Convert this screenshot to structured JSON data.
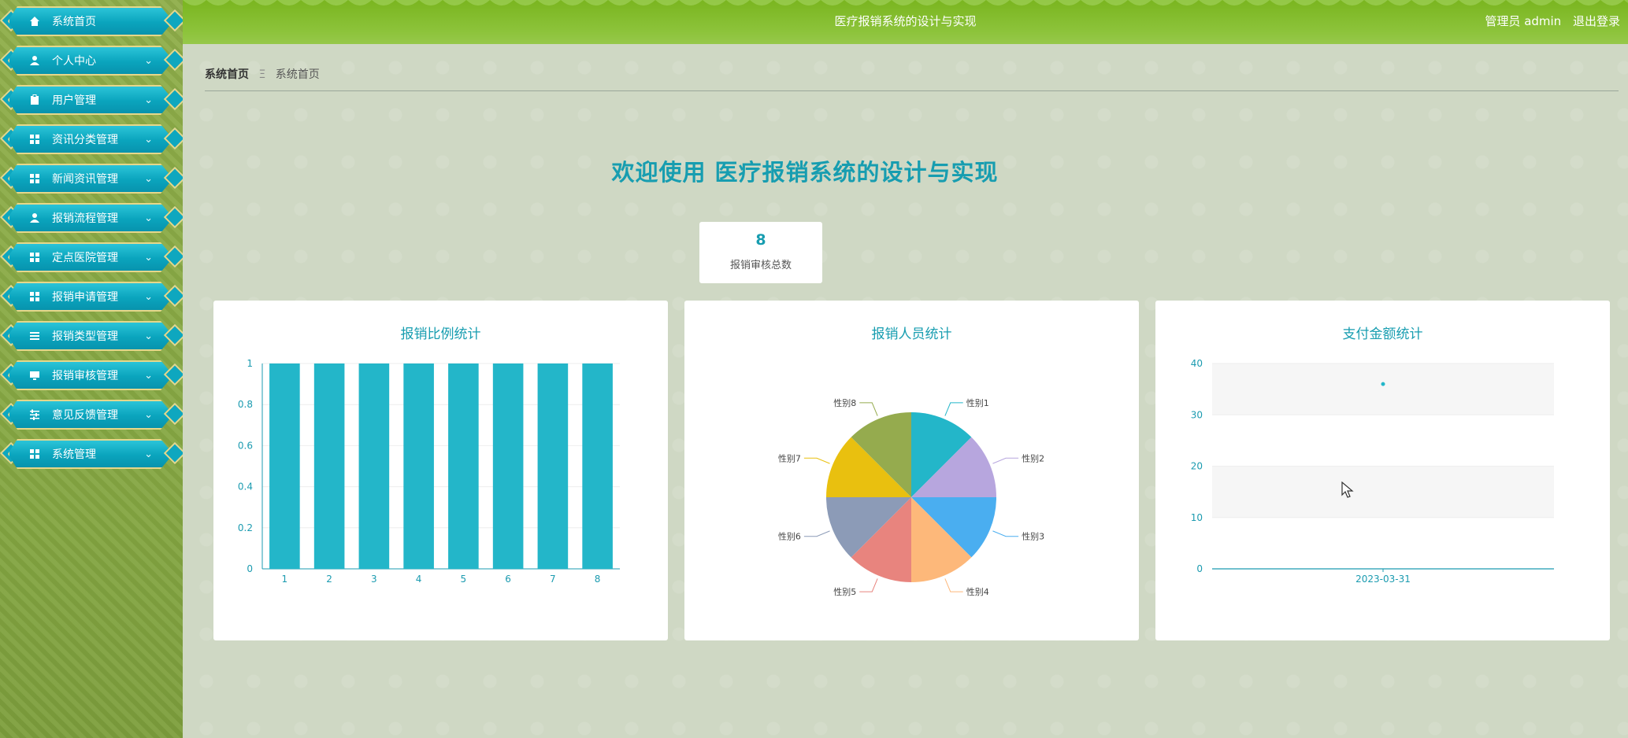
{
  "sidebar": {
    "items": [
      {
        "label": "系统首页",
        "icon": "home-icon"
      },
      {
        "label": "个人中心",
        "icon": "person-icon"
      },
      {
        "label": "用户管理",
        "icon": "clipboard-icon"
      },
      {
        "label": "资讯分类管理",
        "icon": "grid-icon"
      },
      {
        "label": "新闻资讯管理",
        "icon": "grid-icon"
      },
      {
        "label": "报销流程管理",
        "icon": "person-icon"
      },
      {
        "label": "定点医院管理",
        "icon": "grid-icon"
      },
      {
        "label": "报销申请管理",
        "icon": "grid-icon"
      },
      {
        "label": "报销类型管理",
        "icon": "list-icon"
      },
      {
        "label": "报销审核管理",
        "icon": "monitor-icon"
      },
      {
        "label": "意见反馈管理",
        "icon": "sliders-icon"
      },
      {
        "label": "系统管理",
        "icon": "grid-icon"
      }
    ]
  },
  "header": {
    "title": "医疗报销系统的设计与实现",
    "user_role": "管理员 admin",
    "logout": "退出登录"
  },
  "breadcrumb": {
    "root": "系统首页",
    "separator": "Ξ",
    "current": "系统首页"
  },
  "welcome": "欢迎使用 医疗报销系统的设计与实现",
  "stat": {
    "value": "8",
    "label": "报销审核总数"
  },
  "colors": {
    "accent": "#179db0",
    "bar": "#23b6c9",
    "header": "#7ab51f",
    "sidebar": "#86a843"
  },
  "chart_data": [
    {
      "type": "bar",
      "title": "报销比例统计",
      "categories": [
        "1",
        "2",
        "3",
        "4",
        "5",
        "6",
        "7",
        "8"
      ],
      "values": [
        1,
        1,
        1,
        1,
        1,
        1,
        1,
        1
      ],
      "ylim": [
        0,
        1
      ],
      "yticks": [
        "0",
        "0.2",
        "0.4",
        "0.6",
        "0.8",
        "1"
      ]
    },
    {
      "type": "pie",
      "title": "报销人员统计",
      "labels": [
        "性别1",
        "性别2",
        "性别3",
        "性别4",
        "性别5",
        "性别6",
        "性别7",
        "性别8"
      ],
      "values": [
        1,
        1,
        1,
        1,
        1,
        1,
        1,
        1
      ],
      "colors": [
        "#23b6c9",
        "#b7a6de",
        "#4aaef0",
        "#fdb87a",
        "#e8847e",
        "#8c9bb7",
        "#e9c00f",
        "#95ab4e"
      ]
    },
    {
      "type": "scatter",
      "title": "支付金额统计",
      "x": [
        "2023-03-31"
      ],
      "y": [
        36
      ],
      "ylim": [
        0,
        40
      ],
      "yticks": [
        "0",
        "10",
        "20",
        "30",
        "40"
      ]
    }
  ]
}
